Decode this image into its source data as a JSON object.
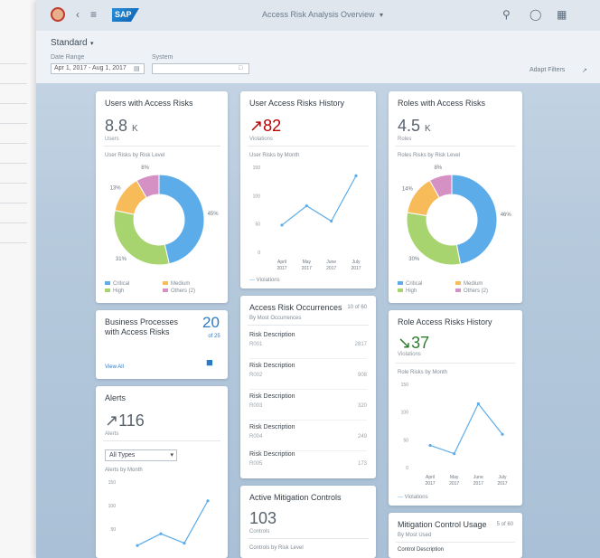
{
  "shell": {
    "title": "Access Risk Analysis Overview",
    "logo": "SAP"
  },
  "filterbar": {
    "variant": "Standard",
    "date_label": "Date Range",
    "date_value": "Apr 1, 2017 - Aug 1, 2017",
    "system_label": "System",
    "system_value": "",
    "adapt_filters": "Adapt Filters"
  },
  "cards": {
    "users_risks": {
      "title": "Users with Access Risks",
      "kpi": "8.8",
      "kpi_unit": "K",
      "kpi_sub": "Users",
      "chart_title": "User Risks by Risk Level",
      "chart_data": {
        "type": "pie",
        "categories": [
          "Critical",
          "Medium",
          "High",
          "Others (2)"
        ],
        "values": [
          45,
          31,
          13,
          8
        ],
        "labels": [
          "45%",
          "31%",
          "13%",
          "8%"
        ],
        "colors": [
          "#5cacea",
          "#a8d46f",
          "#f7bb5a",
          "#d591c3"
        ]
      },
      "legend": [
        "Critical",
        "Medium",
        "High",
        "Others (2)"
      ]
    },
    "user_history": {
      "title": "User Access Risks History",
      "kpi": "82",
      "kpi_sub": "Violations",
      "chart_title": "User Risks by Month",
      "legend": "Violations",
      "chart_data": {
        "type": "line",
        "categories": [
          "April 2017",
          "May 2017",
          "June 2017",
          "July 2017"
        ],
        "x_labels": [
          [
            "April",
            "2017"
          ],
          [
            "May",
            "2017"
          ],
          [
            "June",
            "2017"
          ],
          [
            "July",
            "2017"
          ]
        ],
        "values": [
          48,
          82,
          55,
          135
        ],
        "yticks": [
          "0",
          "50",
          "100",
          "150"
        ],
        "ylim": [
          0,
          150
        ]
      }
    },
    "roles_risks": {
      "title": "Roles with Access Risks",
      "kpi": "4.5",
      "kpi_unit": "K",
      "kpi_sub": "Roles",
      "chart_title": "Roles Risks by Risk Level",
      "chart_data": {
        "type": "pie",
        "categories": [
          "Critical",
          "Medium",
          "High",
          "Others (2)"
        ],
        "values": [
          46,
          30,
          14,
          8
        ],
        "labels": [
          "46%",
          "30%",
          "14%",
          "8%"
        ],
        "colors": [
          "#5cacea",
          "#a8d46f",
          "#f7bb5a",
          "#d591c3"
        ]
      },
      "legend": [
        "Critical",
        "Medium",
        "High",
        "Others (2)"
      ]
    },
    "business_processes": {
      "title": "Business Processes with Access Risks",
      "count": "20",
      "count_sub": "of 25",
      "view_all": "View All"
    },
    "risk_occurrences": {
      "title": "Access Risk Occurrences",
      "count": "10 of 60",
      "subtitle": "By Most Occurrences",
      "items": [
        {
          "title": "Risk Description",
          "id": "R001",
          "value": "2817"
        },
        {
          "title": "Risk Description",
          "id": "R002",
          "value": "908"
        },
        {
          "title": "Risk Description",
          "id": "R003",
          "value": "320"
        },
        {
          "title": "Risk Description",
          "id": "R004",
          "value": "249"
        },
        {
          "title": "Risk Description",
          "id": "R005",
          "value": "173"
        }
      ]
    },
    "role_history": {
      "title": "Role Access Risks History",
      "kpi": "37",
      "kpi_sub": "Violations",
      "chart_title": "Role Risks by Month",
      "legend": "Violations",
      "chart_data": {
        "type": "line",
        "categories": [
          "April 2017",
          "May 2017",
          "June 2017",
          "July 2017"
        ],
        "x_labels": [
          [
            "April",
            "2017"
          ],
          [
            "May",
            "2017"
          ],
          [
            "June",
            "2017"
          ],
          [
            "July",
            "2017"
          ]
        ],
        "values": [
          40,
          25,
          115,
          60
        ],
        "yticks": [
          "0",
          "50",
          "100",
          "150"
        ],
        "ylim": [
          0,
          150
        ]
      }
    },
    "alerts": {
      "title": "Alerts",
      "kpi": "116",
      "kpi_sub": "Alerts",
      "select_value": "All Types",
      "chart_title": "Alerts by Month",
      "chart_data": {
        "type": "line",
        "categories": [
          "April",
          "May",
          "June",
          "July"
        ],
        "values": [
          15,
          40,
          20,
          110
        ],
        "yticks": [
          "50",
          "100",
          "150"
        ],
        "ylim": [
          0,
          150
        ]
      }
    },
    "mitigation_controls": {
      "title": "Active Mitigation Controls",
      "kpi": "103",
      "kpi_sub": "Controls",
      "chart_title": "Controls by Risk Level"
    },
    "mitigation_usage": {
      "title": "Mitigation Control Usage",
      "count": "5 of 60",
      "subtitle": "By Most Used",
      "item": "Control Description"
    }
  }
}
